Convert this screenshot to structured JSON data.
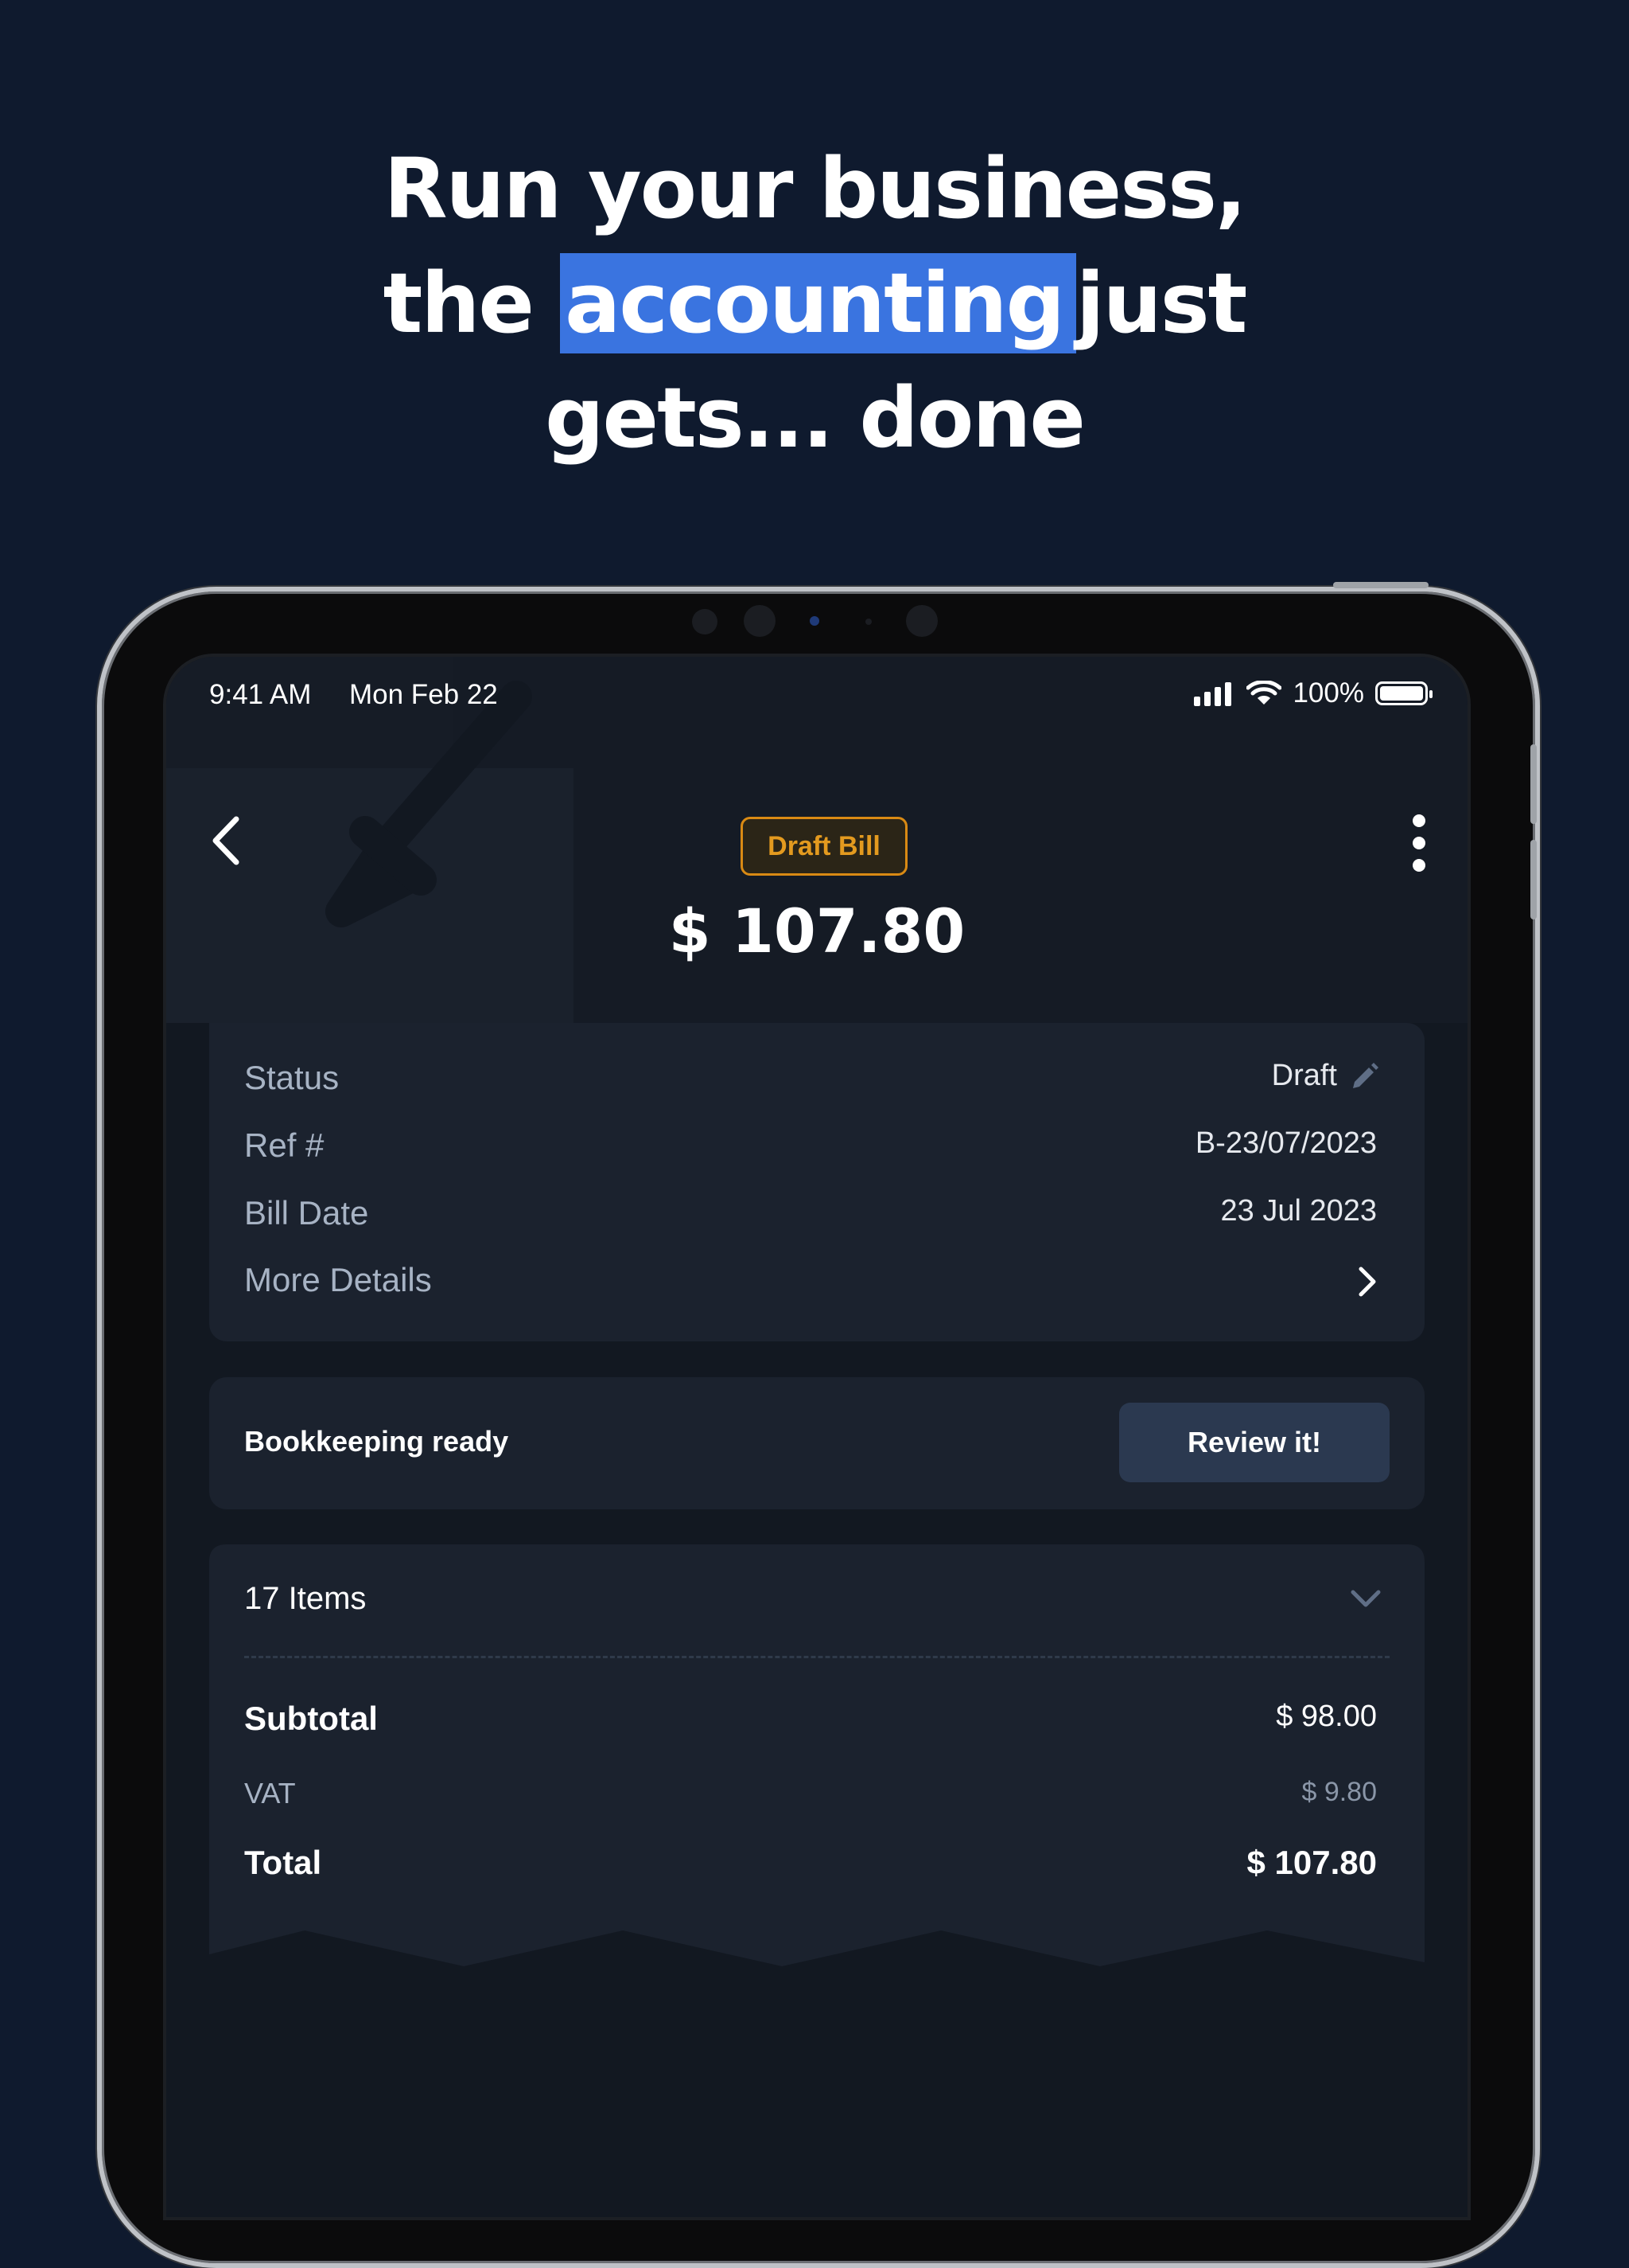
{
  "headline": {
    "line1": "Run your business,",
    "line2_before": "the",
    "line2_highlight": "accounting",
    "line2_after": "just",
    "line3": "gets... done"
  },
  "status_bar": {
    "time": "9:41 AM",
    "date": "Mon Feb 22",
    "battery": "100%"
  },
  "bill": {
    "badge": "Draft Bill",
    "amount": "$ 107.80"
  },
  "details": {
    "status_label": "Status",
    "status_value": "Draft",
    "ref_label": "Ref #",
    "ref_value": "B-23/07/2023",
    "date_label": "Bill Date",
    "date_value": "23 Jul 2023",
    "more_label": "More Details"
  },
  "bookkeeping": {
    "label": "Bookkeeping ready",
    "button": "Review it!"
  },
  "items": {
    "count_label": "17 Items",
    "subtotal_label": "Subtotal",
    "subtotal_value": "$ 98.00",
    "vat_label": "VAT",
    "vat_value": "$ 9.80",
    "total_label": "Total",
    "total_value": "$ 107.80"
  },
  "colors": {
    "background": "#0f1a2e",
    "highlight": "#3a74e0",
    "badge_accent": "#d98a14",
    "card": "#1b222e",
    "button": "#2b3950"
  },
  "icons": [
    "back-chevron-icon",
    "more-vertical-icon",
    "pencil-icon",
    "chevron-right-icon",
    "chevron-down-icon",
    "signal-icon",
    "wifi-icon",
    "battery-icon"
  ]
}
